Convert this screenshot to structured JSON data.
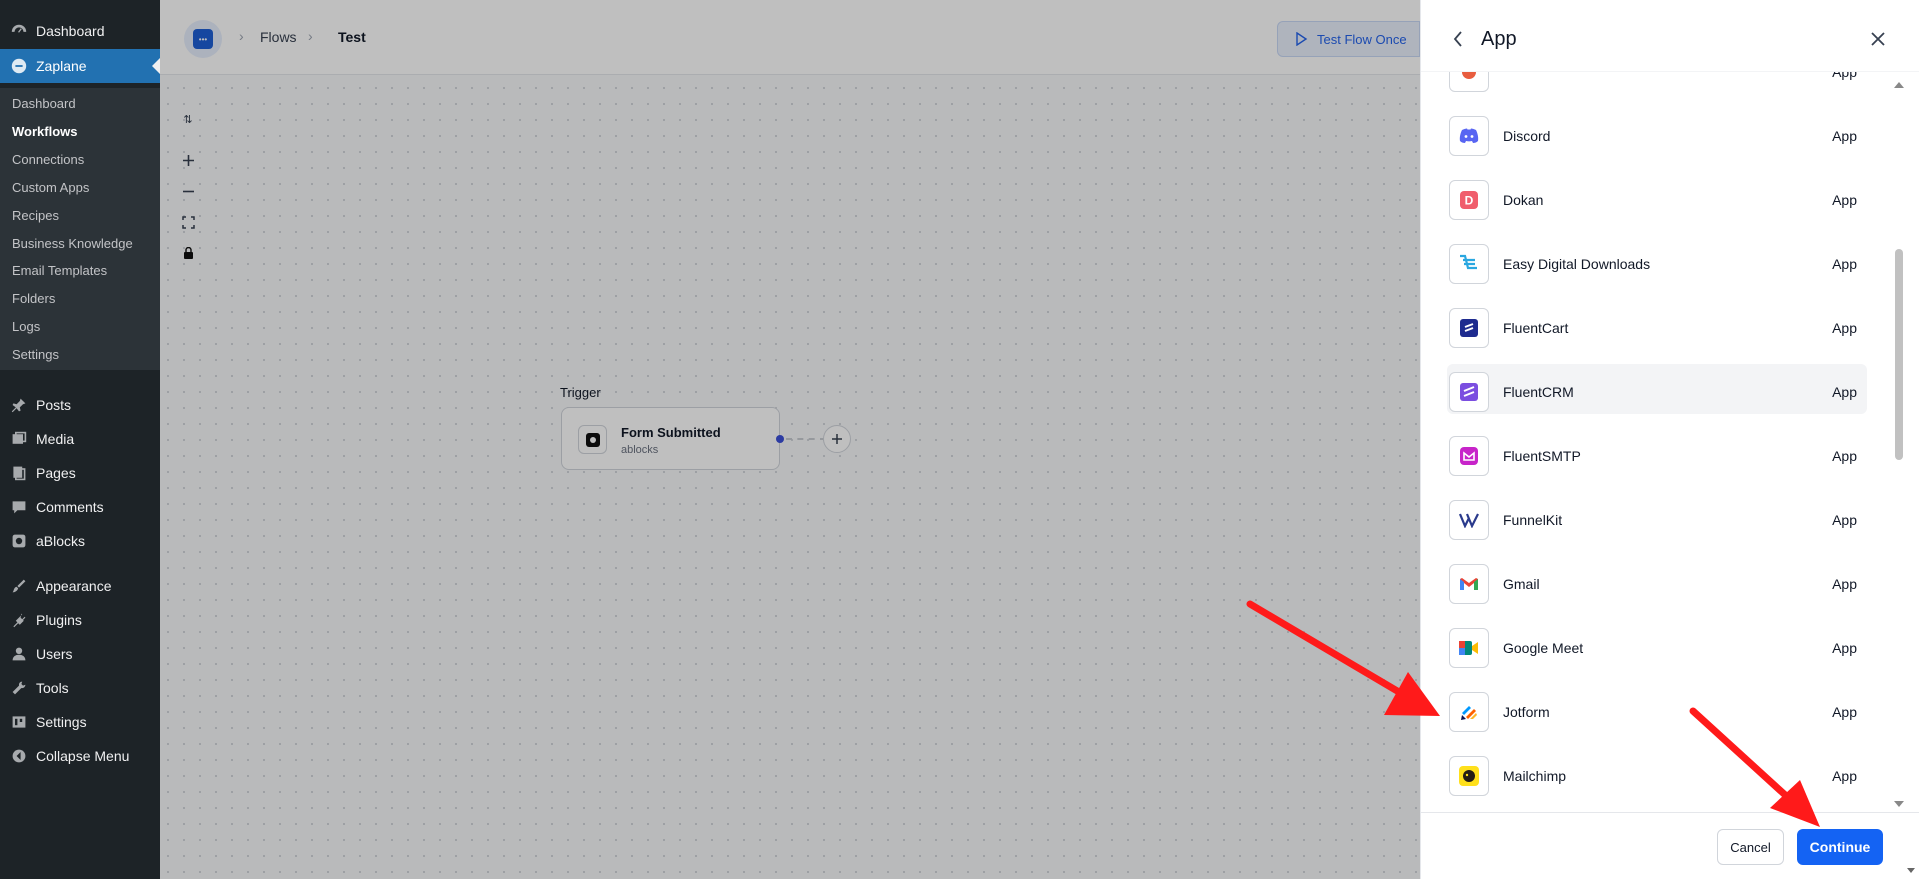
{
  "wp_menu": {
    "top_items": [
      {
        "label": "Dashboard",
        "icon": "dashboard-icon"
      },
      {
        "label": "Zaplane",
        "icon": "zaplane-icon"
      }
    ],
    "submenu": [
      "Dashboard",
      "Workflows",
      "Connections",
      "Custom Apps",
      "Recipes",
      "Business Knowledge",
      "Email Templates",
      "Folders",
      "Logs",
      "Settings"
    ],
    "submenu_current": "Workflows",
    "items": [
      {
        "label": "Posts",
        "icon": "pin-icon"
      },
      {
        "label": "Media",
        "icon": "media-icon"
      },
      {
        "label": "Pages",
        "icon": "pages-icon"
      },
      {
        "label": "Comments",
        "icon": "comment-icon"
      },
      {
        "label": "aBlocks",
        "icon": "ablocks-icon"
      },
      {
        "label": "Appearance",
        "icon": "brush-icon"
      },
      {
        "label": "Plugins",
        "icon": "plug-icon"
      },
      {
        "label": "Users",
        "icon": "user-icon"
      },
      {
        "label": "Tools",
        "icon": "wrench-icon"
      },
      {
        "label": "Settings",
        "icon": "settings-icon"
      },
      {
        "label": "Collapse Menu",
        "icon": "collapse-icon"
      }
    ]
  },
  "breadcrumb": {
    "item1": "Flows",
    "item2": "Test"
  },
  "toolbar": {
    "test_flow_label": "Test Flow Once"
  },
  "flow": {
    "trigger_label": "Trigger",
    "node_title": "Form Submitted",
    "node_subtitle": "ablocks"
  },
  "panel": {
    "title": "App",
    "apps": [
      {
        "name": "Discord",
        "type": "App",
        "icon": "discord-icon",
        "color": "#5865F2"
      },
      {
        "name": "Dokan",
        "type": "App",
        "icon": "dokan-icon",
        "color": "#f05d6c"
      },
      {
        "name": "Easy Digital Downloads",
        "type": "App",
        "icon": "edd-icon",
        "color": "#2aa7e0"
      },
      {
        "name": "FluentCart",
        "type": "App",
        "icon": "fluentcart-icon",
        "color": "#1e2b8f"
      },
      {
        "name": "FluentCRM",
        "type": "App",
        "icon": "fluentcrm-icon",
        "color": "#7b4ee0"
      },
      {
        "name": "FluentSMTP",
        "type": "App",
        "icon": "fluentsmtp-icon",
        "color": "#c724c9"
      },
      {
        "name": "FunnelKit",
        "type": "App",
        "icon": "funnelkit-icon",
        "color": "#2a3a8c"
      },
      {
        "name": "Gmail",
        "type": "App",
        "icon": "gmail-icon",
        "color": "#ea4335"
      },
      {
        "name": "Google Meet",
        "type": "App",
        "icon": "google-meet-icon",
        "color": "#00897b"
      },
      {
        "name": "Jotform",
        "type": "App",
        "icon": "jotform-icon",
        "color": "#ff6100"
      },
      {
        "name": "Mailchimp",
        "type": "App",
        "icon": "mailchimp-icon",
        "color": "#ffe01b"
      }
    ],
    "partial_row_type": "App",
    "cancel_label": "Cancel",
    "continue_label": "Continue"
  },
  "colors": {
    "accent": "#1463f3",
    "annotation_arrow": "#ff1a1a"
  }
}
